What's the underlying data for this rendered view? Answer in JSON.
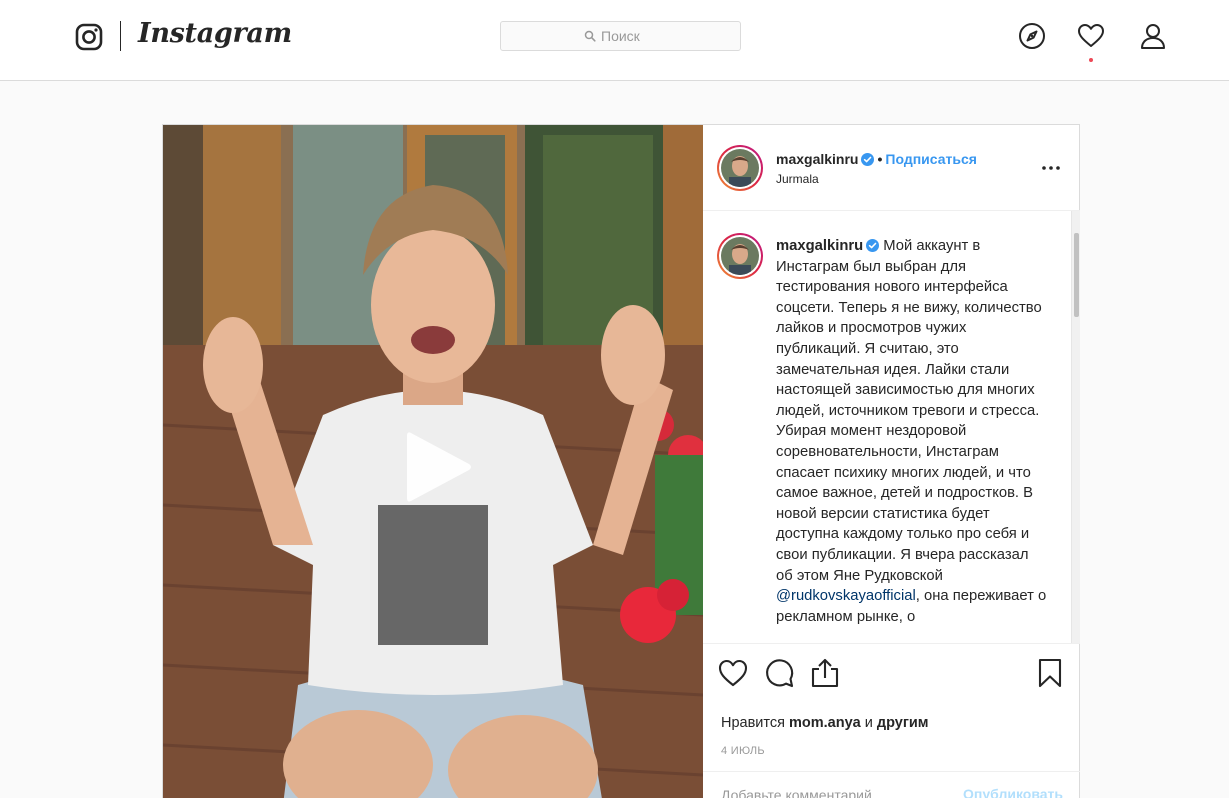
{
  "nav": {
    "wordmark": "Instagram",
    "search_placeholder": "Поиск",
    "icons": [
      "instagram-glyph-icon",
      "compass-icon",
      "heart-icon",
      "profile-icon"
    ]
  },
  "post": {
    "username": "maxgalkinru",
    "follow_label": "Подписаться",
    "dot": "•",
    "location": "Jurmala",
    "caption_text": "Мой аккаунт в Инстаграм был выбран для тестирования нового интерфейса соцсети. Теперь я не вижу, количество лайков и просмотров чужих публикаций. Я считаю, это замечательная идея. Лайки стали настоящей зависимостью для многих людей, источником тревоги и стресса. Убирая момент нездоровой соревновательности, Инстаграм спасает психику многих людей, и что самое важное, детей и подростков. В новой версии статистика будет доступна каждому только про себя и свои публикации. Я вчера рассказал об этом Яне Рудковской",
    "caption_mention": "@rudkovskayaofficial",
    "caption_tail": ", она переживает о рекламном рынке, о",
    "likes_prefix": "Нравится",
    "likes_user": "mom.anya",
    "likes_and": "и",
    "likes_others": "другим",
    "date": "4 ИЮЛЬ",
    "comment_placeholder": "Добавьте комментарий...",
    "publish_label": "Опубликовать"
  },
  "colors": {
    "accent": "#3897f0",
    "notification_dot": "#ed4956",
    "verified": "#3897f0"
  }
}
